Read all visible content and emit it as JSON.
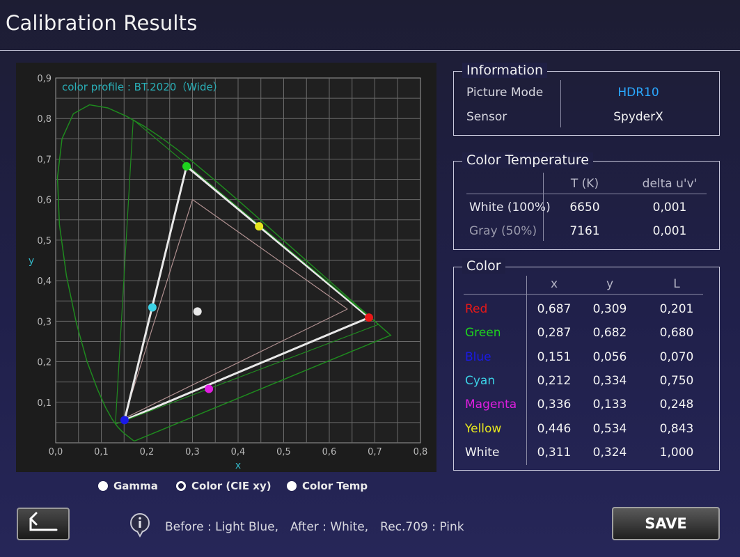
{
  "title": "Calibration Results",
  "chart_data": {
    "type": "scatter",
    "title": "color profile :  BT.2020（Wide）",
    "xlabel": "x",
    "ylabel": "y",
    "xlim": [
      0.0,
      0.8
    ],
    "ylim": [
      0.0,
      0.9
    ],
    "x_ticks": [
      "0,0",
      "0,1",
      "0,2",
      "0,3",
      "0,4",
      "0,5",
      "0,6",
      "0,7",
      "0,8"
    ],
    "y_ticks": [
      "0,1",
      "0,2",
      "0,3",
      "0,4",
      "0,5",
      "0,6",
      "0,7",
      "0,8",
      "0,9"
    ],
    "grid": true,
    "series": [
      {
        "name": "Before",
        "color": "#4ad2e6",
        "points": [
          [
            0.212,
            0.334
          ]
        ]
      },
      {
        "name": "After",
        "color": "#e8e8e8",
        "points": [
          [
            0.687,
            0.309
          ],
          [
            0.287,
            0.682
          ],
          [
            0.151,
            0.056
          ],
          [
            0.687,
            0.309
          ]
        ]
      },
      {
        "name": "Rec.709",
        "color": "#b09090",
        "points": [
          [
            0.64,
            0.33
          ],
          [
            0.3,
            0.6
          ],
          [
            0.15,
            0.06
          ],
          [
            0.64,
            0.33
          ]
        ]
      },
      {
        "name": "BT.2020",
        "color": "#208a20",
        "points": [
          [
            0.708,
            0.292
          ],
          [
            0.17,
            0.797
          ],
          [
            0.131,
            0.046
          ],
          [
            0.708,
            0.292
          ]
        ]
      }
    ],
    "markers": [
      {
        "name": "Red",
        "x": 0.687,
        "y": 0.309,
        "color": "#e81818"
      },
      {
        "name": "Green",
        "x": 0.287,
        "y": 0.682,
        "color": "#1ed21e"
      },
      {
        "name": "Blue",
        "x": 0.151,
        "y": 0.056,
        "color": "#1a1ae6"
      },
      {
        "name": "Cyan",
        "x": 0.212,
        "y": 0.334,
        "color": "#3cd2e6"
      },
      {
        "name": "Magenta",
        "x": 0.336,
        "y": 0.133,
        "color": "#e01ee0"
      },
      {
        "name": "Yellow",
        "x": 0.446,
        "y": 0.534,
        "color": "#e6e61e"
      },
      {
        "name": "White",
        "x": 0.311,
        "y": 0.324,
        "color": "#e8e8e8"
      }
    ]
  },
  "info": {
    "legend": "Information",
    "picture_mode_label": "Picture Mode",
    "picture_mode_value": "HDR10",
    "sensor_label": "Sensor",
    "sensor_value": "SpyderX",
    "accent": "#2aa8ff"
  },
  "color_temp": {
    "legend": "Color Temperature",
    "headers": [
      "T (K)",
      "delta u'v'"
    ],
    "rows": [
      {
        "label": "White (100%)",
        "t": "6650",
        "delta": "0,001"
      },
      {
        "label": "Gray (50%)",
        "t": "7161",
        "delta": "0,001"
      }
    ]
  },
  "color": {
    "legend": "Color",
    "headers": [
      "x",
      "y",
      "L"
    ],
    "rows": [
      {
        "label": "Red",
        "x": "0,687",
        "y": "0,309",
        "L": "0,201",
        "color": "#e81818"
      },
      {
        "label": "Green",
        "x": "0,287",
        "y": "0,682",
        "L": "0,680",
        "color": "#1ed21e"
      },
      {
        "label": "Blue",
        "x": "0,151",
        "y": "0,056",
        "L": "0,070",
        "color": "#1a1ae6"
      },
      {
        "label": "Cyan",
        "x": "0,212",
        "y": "0,334",
        "L": "0,750",
        "color": "#3cd2e6"
      },
      {
        "label": "Magenta",
        "x": "0,336",
        "y": "0,133",
        "L": "0,248",
        "color": "#e01ee0"
      },
      {
        "label": "Yellow",
        "x": "0,446",
        "y": "0,534",
        "L": "0,843",
        "color": "#e6e61e"
      },
      {
        "label": "White",
        "x": "0,311",
        "y": "0,324",
        "L": "1,000",
        "color": "#f0f0f0"
      }
    ]
  },
  "modes": {
    "gamma": "Gamma",
    "color_cie": "Color (CIE xy)",
    "color_temp": "Color Temp",
    "selected": "color_cie"
  },
  "footer": {
    "info_icon": "info-icon",
    "note": "Before : Light Blue,　After : White,　Rec.709 : Pink",
    "back_icon": "return-arrow-icon",
    "save_label": "SAVE"
  }
}
